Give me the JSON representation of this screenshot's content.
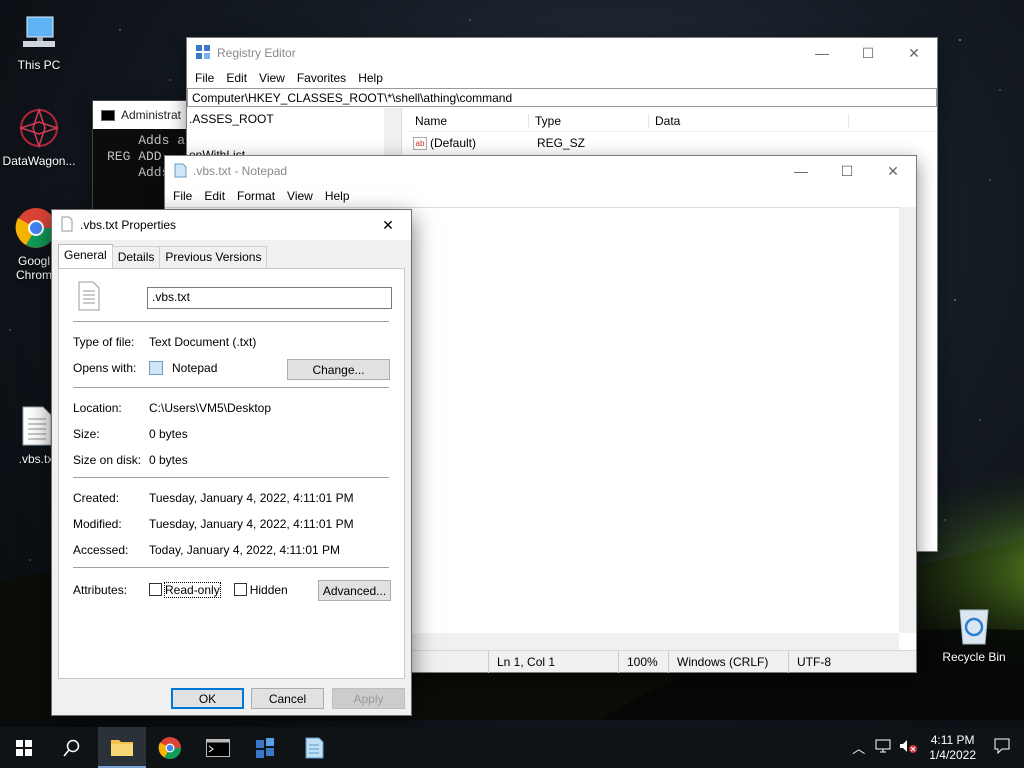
{
  "desktop": {
    "icons": [
      {
        "label": "This PC",
        "icon": "computer-icon"
      },
      {
        "label": "DataWagon...",
        "icon": "datawagon-icon"
      },
      {
        "label": "Googl Chrom",
        "icon": "chrome-icon"
      },
      {
        "label": ".vbs.tx",
        "icon": "text-file-icon"
      },
      {
        "label": "Recycle Bin",
        "icon": "recycle-bin-icon"
      }
    ]
  },
  "cmd": {
    "title": "Administrat",
    "lines": [
      "    Adds a k",
      "",
      "REG ADD",
      "    Adds"
    ]
  },
  "regedit": {
    "title": "Registry Editor",
    "menu": [
      "File",
      "Edit",
      "View",
      "Favorites",
      "Help"
    ],
    "address": "Computer\\HKEY_CLASSES_ROOT\\*\\shell\\athing\\command",
    "tree_items": [
      ".ASSES_ROOT",
      "enWithList"
    ],
    "columns": [
      "Name",
      "Type",
      "Data"
    ],
    "rows": [
      {
        "name": "(Default)",
        "type": "REG_SZ",
        "data": ""
      }
    ]
  },
  "notepad": {
    "title": ".vbs.txt - Notepad",
    "menu": [
      "File",
      "Edit",
      "Format",
      "View",
      "Help"
    ],
    "status": {
      "position": "Ln 1, Col 1",
      "zoom": "100%",
      "line_ending": "Windows (CRLF)",
      "encoding": "UTF-8"
    }
  },
  "properties": {
    "title": ".vbs.txt Properties",
    "tabs": [
      "General",
      "Details",
      "Previous Versions"
    ],
    "filename": ".vbs.txt",
    "type_label": "Type of file:",
    "type_value": "Text Document (.txt)",
    "opens_label": "Opens with:",
    "opens_value": "Notepad",
    "change_label": "Change...",
    "location_label": "Location:",
    "location_value": "C:\\Users\\VM5\\Desktop",
    "size_label": "Size:",
    "size_value": "0 bytes",
    "size_on_disk_label": "Size on disk:",
    "size_on_disk_value": "0 bytes",
    "created_label": "Created:",
    "created_value": "Tuesday, January 4, 2022, 4:11:01 PM",
    "modified_label": "Modified:",
    "modified_value": "Tuesday, January 4, 2022, 4:11:01 PM",
    "accessed_label": "Accessed:",
    "accessed_value": "Today, January 4, 2022, 4:11:01 PM",
    "attributes_label": "Attributes:",
    "readonly_label": "Read-only",
    "hidden_label": "Hidden",
    "advanced_label": "Advanced...",
    "ok_label": "OK",
    "cancel_label": "Cancel",
    "apply_label": "Apply"
  },
  "taskbar": {
    "apps": [
      "start-icon",
      "search-icon",
      "file-explorer-icon",
      "chrome-icon",
      "terminal-icon",
      "registry-editor-icon",
      "notepad-icon"
    ],
    "time": "4:11 PM",
    "date": "1/4/2022"
  },
  "colors": {
    "accent": "#0078d7",
    "taskbar": "#101316",
    "button_face": "#e1e1e1"
  }
}
